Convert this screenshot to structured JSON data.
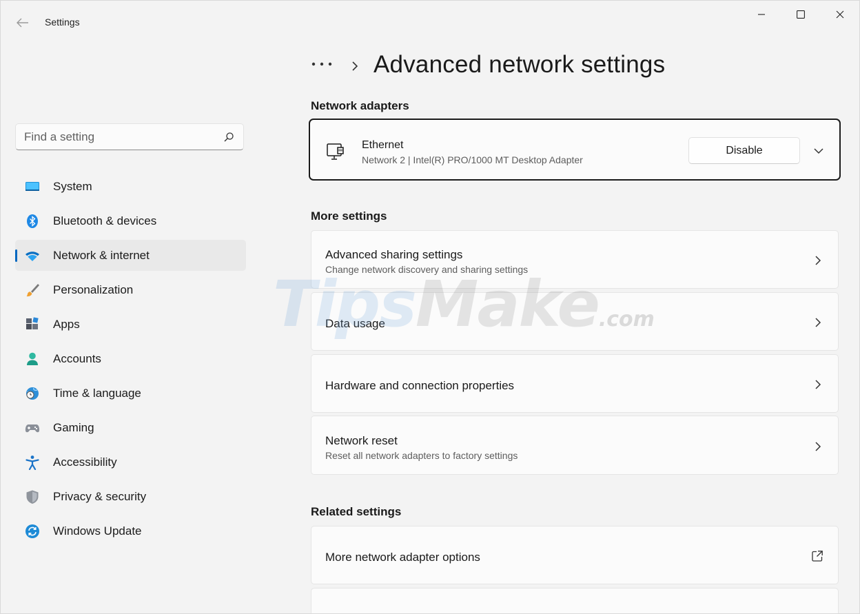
{
  "window": {
    "app_title": "Settings",
    "controls": [
      "minimize-icon",
      "maximize-icon",
      "close-icon"
    ]
  },
  "sidebar": {
    "search": {
      "placeholder": "Find a setting",
      "value": ""
    },
    "items": [
      {
        "label": "System",
        "icon": "system-icon",
        "active": false
      },
      {
        "label": "Bluetooth & devices",
        "icon": "bluetooth-icon",
        "active": false
      },
      {
        "label": "Network & internet",
        "icon": "wifi-icon",
        "active": true
      },
      {
        "label": "Personalization",
        "icon": "brush-icon",
        "active": false
      },
      {
        "label": "Apps",
        "icon": "apps-icon",
        "active": false
      },
      {
        "label": "Accounts",
        "icon": "account-icon",
        "active": false
      },
      {
        "label": "Time & language",
        "icon": "globe-clock-icon",
        "active": false
      },
      {
        "label": "Gaming",
        "icon": "gamepad-icon",
        "active": false
      },
      {
        "label": "Accessibility",
        "icon": "accessibility-icon",
        "active": false
      },
      {
        "label": "Privacy & security",
        "icon": "shield-icon",
        "active": false
      },
      {
        "label": "Windows Update",
        "icon": "update-icon",
        "active": false
      }
    ]
  },
  "main": {
    "breadcrumb_more": "•••",
    "title": "Advanced network settings",
    "sections": {
      "adapters": "Network adapters",
      "more": "More settings",
      "related": "Related settings"
    },
    "adapter": {
      "name": "Ethernet",
      "description": "Network 2 | Intel(R) PRO/1000 MT Desktop Adapter",
      "button": "Disable"
    },
    "more_settings": [
      {
        "title": "Advanced sharing settings",
        "subtitle": "Change network discovery and sharing settings"
      },
      {
        "title": "Data usage",
        "subtitle": ""
      },
      {
        "title": "Hardware and connection properties",
        "subtitle": ""
      },
      {
        "title": "Network reset",
        "subtitle": "Reset all network adapters to factory settings"
      }
    ],
    "related_settings": [
      {
        "title": "More network adapter options",
        "icon": "open-external-icon"
      }
    ]
  },
  "watermark": {
    "brand": "TipsMake",
    "part1": "Tips",
    "part2": "Make",
    "domain": ".com"
  },
  "colors": {
    "accent": "#0067c0",
    "background": "#f3f3f3",
    "card": "#fbfbfb"
  }
}
